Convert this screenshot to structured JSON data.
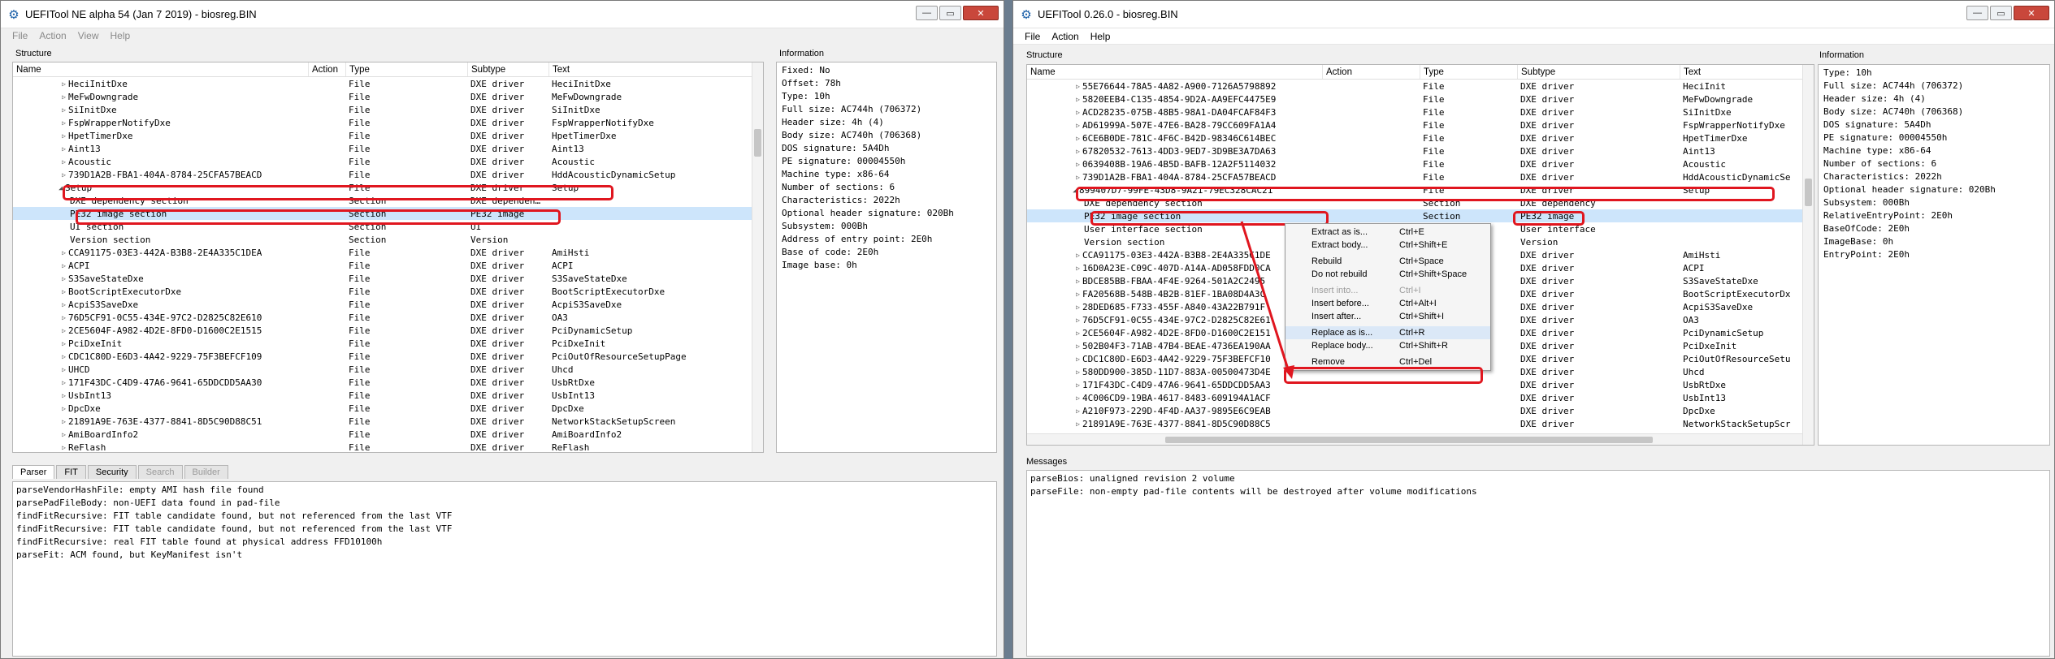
{
  "left_window": {
    "title": "UEFITool NE alpha 54 (Jan  7 2019) - biosreg.BIN",
    "menu": [
      "File",
      "Action",
      "View",
      "Help"
    ],
    "structure_label": "Structure",
    "info_label": "Information",
    "columns": [
      "Name",
      "Action",
      "Type",
      "Subtype",
      "Text"
    ],
    "rows": [
      {
        "name": "HeciInitDxe",
        "type": "File",
        "subtype": "DXE driver",
        "text": "HeciInitDxe",
        "level": 1,
        "exp": "▷"
      },
      {
        "name": "MeFwDowngrade",
        "type": "File",
        "subtype": "DXE driver",
        "text": "MeFwDowngrade",
        "level": 1,
        "exp": "▷"
      },
      {
        "name": "SiInitDxe",
        "type": "File",
        "subtype": "DXE driver",
        "text": "SiInitDxe",
        "level": 1,
        "exp": "▷"
      },
      {
        "name": "FspWrapperNotifyDxe",
        "type": "File",
        "subtype": "DXE driver",
        "text": "FspWrapperNotifyDxe",
        "level": 1,
        "exp": "▷"
      },
      {
        "name": "HpetTimerDxe",
        "type": "File",
        "subtype": "DXE driver",
        "text": "HpetTimerDxe",
        "level": 1,
        "exp": "▷"
      },
      {
        "name": "Aint13",
        "type": "File",
        "subtype": "DXE driver",
        "text": "Aint13",
        "level": 1,
        "exp": "▷"
      },
      {
        "name": "Acoustic",
        "type": "File",
        "subtype": "DXE driver",
        "text": "Acoustic",
        "level": 1,
        "exp": "▷"
      },
      {
        "name": "739D1A2B-FBA1-404A-8784-25CFA57BEACD",
        "type": "File",
        "subtype": "DXE driver",
        "text": "HddAcousticDynamicSetup",
        "level": 1,
        "exp": "▷"
      },
      {
        "name": "Setup",
        "type": "File",
        "subtype": "DXE driver",
        "text": "Setup",
        "level": 0,
        "exp": "◢"
      },
      {
        "name": "DXE dependency section",
        "type": "Section",
        "subtype": "DXE dependen…",
        "text": "",
        "level": 2,
        "exp": ""
      },
      {
        "name": "PE32 image section",
        "type": "Section",
        "subtype": "PE32 image",
        "text": "",
        "level": 2,
        "exp": "",
        "selected": true
      },
      {
        "name": "UI section",
        "type": "Section",
        "subtype": "UI",
        "text": "",
        "level": 2,
        "exp": ""
      },
      {
        "name": "Version section",
        "type": "Section",
        "subtype": "Version",
        "text": "",
        "level": 2,
        "exp": ""
      },
      {
        "name": "CCA91175-03E3-442A-B3B8-2E4A335C1DEA",
        "type": "File",
        "subtype": "DXE driver",
        "text": "AmiHsti",
        "level": 1,
        "exp": "▷"
      },
      {
        "name": "ACPI",
        "type": "File",
        "subtype": "DXE driver",
        "text": "ACPI",
        "level": 1,
        "exp": "▷"
      },
      {
        "name": "S3SaveStateDxe",
        "type": "File",
        "subtype": "DXE driver",
        "text": "S3SaveStateDxe",
        "level": 1,
        "exp": "▷"
      },
      {
        "name": "BootScriptExecutorDxe",
        "type": "File",
        "subtype": "DXE driver",
        "text": "BootScriptExecutorDxe",
        "level": 1,
        "exp": "▷"
      },
      {
        "name": "AcpiS3SaveDxe",
        "type": "File",
        "subtype": "DXE driver",
        "text": "AcpiS3SaveDxe",
        "level": 1,
        "exp": "▷"
      },
      {
        "name": "76D5CF91-0C55-434E-97C2-D2825C82E610",
        "type": "File",
        "subtype": "DXE driver",
        "text": "OA3",
        "level": 1,
        "exp": "▷"
      },
      {
        "name": "2CE5604F-A982-4D2E-8FD0-D1600C2E1515",
        "type": "File",
        "subtype": "DXE driver",
        "text": "PciDynamicSetup",
        "level": 1,
        "exp": "▷"
      },
      {
        "name": "PciDxeInit",
        "type": "File",
        "subtype": "DXE driver",
        "text": "PciDxeInit",
        "level": 1,
        "exp": "▷"
      },
      {
        "name": "CDC1C80D-E6D3-4A42-9229-75F3BEFCF109",
        "type": "File",
        "subtype": "DXE driver",
        "text": "PciOutOfResourceSetupPage",
        "level": 1,
        "exp": "▷"
      },
      {
        "name": "UHCD",
        "type": "File",
        "subtype": "DXE driver",
        "text": "Uhcd",
        "level": 1,
        "exp": "▷"
      },
      {
        "name": "171F43DC-C4D9-47A6-9641-65DDCDD5AA30",
        "type": "File",
        "subtype": "DXE driver",
        "text": "UsbRtDxe",
        "level": 1,
        "exp": "▷"
      },
      {
        "name": "UsbInt13",
        "type": "File",
        "subtype": "DXE driver",
        "text": "UsbInt13",
        "level": 1,
        "exp": "▷"
      },
      {
        "name": "DpcDxe",
        "type": "File",
        "subtype": "DXE driver",
        "text": "DpcDxe",
        "level": 1,
        "exp": "▷"
      },
      {
        "name": "21891A9E-763E-4377-8841-8D5C90D88C51",
        "type": "File",
        "subtype": "DXE driver",
        "text": "NetworkStackSetupScreen",
        "level": 1,
        "exp": "▷"
      },
      {
        "name": "AmiBoardInfo2",
        "type": "File",
        "subtype": "DXE driver",
        "text": "AmiBoardInfo2",
        "level": 1,
        "exp": "▷"
      },
      {
        "name": "ReFlash",
        "type": "File",
        "subtype": "DXE driver",
        "text": "ReFlash",
        "level": 1,
        "exp": "▷"
      }
    ],
    "info": "Fixed: No\nOffset: 78h\nType: 10h\nFull size: AC744h (706372)\nHeader size: 4h (4)\nBody size: AC740h (706368)\nDOS signature: 5A4Dh\nPE signature: 00004550h\nMachine type: x86-64\nNumber of sections: 6\nCharacteristics: 2022h\nOptional header signature: 020Bh\nSubsystem: 000Bh\nAddress of entry point: 2E0h\nBase of code: 2E0h\nImage base: 0h",
    "tabs": [
      {
        "label": "Parser",
        "active": true,
        "disabled": false
      },
      {
        "label": "FIT",
        "active": false,
        "disabled": false
      },
      {
        "label": "Security",
        "active": false,
        "disabled": false
      },
      {
        "label": "Search",
        "active": false,
        "disabled": true
      },
      {
        "label": "Builder",
        "active": false,
        "disabled": true
      }
    ],
    "messages": "parseVendorHashFile: empty AMI hash file found\nparsePadFileBody: non-UEFI data found in pad-file\nfindFitRecursive: FIT table candidate found, but not referenced from the last VTF\nfindFitRecursive: FIT table candidate found, but not referenced from the last VTF\nfindFitRecursive: real FIT table found at physical address FFD10100h\nparseFit: ACM found, but KeyManifest isn't"
  },
  "right_window": {
    "title": "UEFITool 0.26.0 - biosreg.BIN",
    "menu": [
      "File",
      "Action",
      "Help"
    ],
    "structure_label": "Structure",
    "info_label": "Information",
    "messages_label": "Messages",
    "columns": [
      "Name",
      "Action",
      "Type",
      "Subtype",
      "Text"
    ],
    "rows": [
      {
        "name": "55E76644-78A5-4A82-A900-7126A5798892",
        "type": "File",
        "subtype": "DXE driver",
        "text": "HeciInit",
        "level": 1,
        "exp": "▷"
      },
      {
        "name": "5820EEB4-C135-4854-9D2A-AA9EFC4475E9",
        "type": "File",
        "subtype": "DXE driver",
        "text": "MeFwDowngrade",
        "level": 1,
        "exp": "▷"
      },
      {
        "name": "ACD28235-075B-48B5-98A1-DA04FCAF84F3",
        "type": "File",
        "subtype": "DXE driver",
        "text": "SiInitDxe",
        "level": 1,
        "exp": "▷"
      },
      {
        "name": "AD61999A-507E-47E6-BA28-79CC609FA1A4",
        "type": "File",
        "subtype": "DXE driver",
        "text": "FspWrapperNotifyDxe",
        "level": 1,
        "exp": "▷"
      },
      {
        "name": "6CE6B0DE-781C-4F6C-B42D-98346C614BEC",
        "type": "File",
        "subtype": "DXE driver",
        "text": "HpetTimerDxe",
        "level": 1,
        "exp": "▷"
      },
      {
        "name": "67820532-7613-4DD3-9ED7-3D9BE3A7DA63",
        "type": "File",
        "subtype": "DXE driver",
        "text": "Aint13",
        "level": 1,
        "exp": "▷"
      },
      {
        "name": "0639408B-19A6-4B5D-BAFB-12A2F5114032",
        "type": "File",
        "subtype": "DXE driver",
        "text": "Acoustic",
        "level": 1,
        "exp": "▷"
      },
      {
        "name": "739D1A2B-FBA1-404A-8784-25CFA57BEACD",
        "type": "File",
        "subtype": "DXE driver",
        "text": "HddAcousticDynamicSe",
        "level": 1,
        "exp": "▷"
      },
      {
        "name": "899407D7-99FE-43D8-9A21-79EC328CAC21",
        "type": "File",
        "subtype": "DXE driver",
        "text": "Setup",
        "level": 0,
        "exp": "◢"
      },
      {
        "name": "DXE dependency section",
        "type": "Section",
        "subtype": "DXE dependency",
        "text": "",
        "level": 2,
        "exp": ""
      },
      {
        "name": "PE32 image section",
        "type": "Section",
        "subtype": "PE32 image",
        "text": "",
        "level": 2,
        "exp": "",
        "selected": true
      },
      {
        "name": "User interface section",
        "type": "",
        "subtype": "User interface",
        "text": "",
        "level": 2,
        "exp": ""
      },
      {
        "name": "Version section",
        "type": "",
        "subtype": "Version",
        "text": "",
        "level": 2,
        "exp": ""
      },
      {
        "name": "CCA91175-03E3-442A-B3B8-2E4A335C1DE",
        "type": "",
        "subtype": "DXE driver",
        "text": "AmiHsti",
        "level": 1,
        "exp": "▷"
      },
      {
        "name": "16D0A23E-C09C-407D-A14A-AD058FDD0CA",
        "type": "",
        "subtype": "DXE driver",
        "text": "ACPI",
        "level": 1,
        "exp": "▷"
      },
      {
        "name": "BDCE85BB-FBAA-4F4E-9264-501A2C2495",
        "type": "",
        "subtype": "DXE driver",
        "text": "S3SaveStateDxe",
        "level": 1,
        "exp": "▷"
      },
      {
        "name": "FA20568B-548B-4B2B-81EF-1BA08D4A3C",
        "type": "",
        "subtype": "DXE driver",
        "text": "BootScriptExecutorDx",
        "level": 1,
        "exp": "▷"
      },
      {
        "name": "28DED685-F733-455F-A840-43A22B791F",
        "type": "",
        "subtype": "DXE driver",
        "text": "AcpiS3SaveDxe",
        "level": 1,
        "exp": "▷"
      },
      {
        "name": "76D5CF91-0C55-434E-97C2-D2825C82E61",
        "type": "",
        "subtype": "DXE driver",
        "text": "OA3",
        "level": 1,
        "exp": "▷"
      },
      {
        "name": "2CE5604F-A982-4D2E-8FD0-D1600C2E151",
        "type": "",
        "subtype": "DXE driver",
        "text": "PciDynamicSetup",
        "level": 1,
        "exp": "▷"
      },
      {
        "name": "502B04F3-71AB-47B4-BEAE-4736EA190AA",
        "type": "",
        "subtype": "DXE driver",
        "text": "PciDxeInit",
        "level": 1,
        "exp": "▷"
      },
      {
        "name": "CDC1C80D-E6D3-4A42-9229-75F3BEFCF10",
        "type": "",
        "subtype": "DXE driver",
        "text": "PciOutOfResourceSetu",
        "level": 1,
        "exp": "▷"
      },
      {
        "name": "580DD900-385D-11D7-883A-00500473D4E",
        "type": "",
        "subtype": "DXE driver",
        "text": "Uhcd",
        "level": 1,
        "exp": "▷"
      },
      {
        "name": "171F43DC-C4D9-47A6-9641-65DDCDD5AA3",
        "type": "",
        "subtype": "DXE driver",
        "text": "UsbRtDxe",
        "level": 1,
        "exp": "▷"
      },
      {
        "name": "4C006CD9-19BA-4617-8483-609194A1ACF",
        "type": "",
        "subtype": "DXE driver",
        "text": "UsbInt13",
        "level": 1,
        "exp": "▷"
      },
      {
        "name": "A210F973-229D-4F4D-AA37-9895E6C9EAB",
        "type": "",
        "subtype": "DXE driver",
        "text": "DpcDxe",
        "level": 1,
        "exp": "▷"
      },
      {
        "name": "21891A9E-763E-4377-8841-8D5C90D88C5",
        "type": "",
        "subtype": "DXE driver",
        "text": "NetworkStackSetupScr",
        "level": 1,
        "exp": "▷"
      }
    ],
    "info": "Type: 10h\nFull size: AC744h (706372)\nHeader size: 4h (4)\nBody size: AC740h (706368)\nDOS signature: 5A4Dh\nPE signature: 00004550h\nMachine type: x86-64\nNumber of sections: 6\nCharacteristics: 2022h\nOptional header signature: 020Bh\nSubsystem: 000Bh\nRelativeEntryPoint: 2E0h\nBaseOfCode: 2E0h\nImageBase: 0h\nEntryPoint: 2E0h",
    "messages": "parseBios: unaligned revision 2 volume\nparseFile: non-empty pad-file contents will be destroyed after volume modifications",
    "context_menu": [
      {
        "label": "Extract as is...",
        "shortcut": "Ctrl+E",
        "disabled": false,
        "gap": false
      },
      {
        "label": "Extract body...",
        "shortcut": "Ctrl+Shift+E",
        "disabled": false,
        "gap": false
      },
      {
        "label": "Rebuild",
        "shortcut": "Ctrl+Space",
        "disabled": false,
        "gap": true
      },
      {
        "label": "Do not rebuild",
        "shortcut": "Ctrl+Shift+Space",
        "disabled": false,
        "gap": false
      },
      {
        "label": "Insert into...",
        "shortcut": "Ctrl+I",
        "disabled": true,
        "gap": true
      },
      {
        "label": "Insert before...",
        "shortcut": "Ctrl+Alt+I",
        "disabled": false,
        "gap": false
      },
      {
        "label": "Insert after...",
        "shortcut": "Ctrl+Shift+I",
        "disabled": false,
        "gap": false
      },
      {
        "label": "Replace as is...",
        "shortcut": "Ctrl+R",
        "disabled": false,
        "gap": true,
        "highlight": true
      },
      {
        "label": "Replace body...",
        "shortcut": "Ctrl+Shift+R",
        "disabled": false,
        "gap": false
      },
      {
        "label": "Remove",
        "shortcut": "Ctrl+Del",
        "disabled": false,
        "gap": true
      }
    ]
  },
  "annotation_color": "#e0161f"
}
